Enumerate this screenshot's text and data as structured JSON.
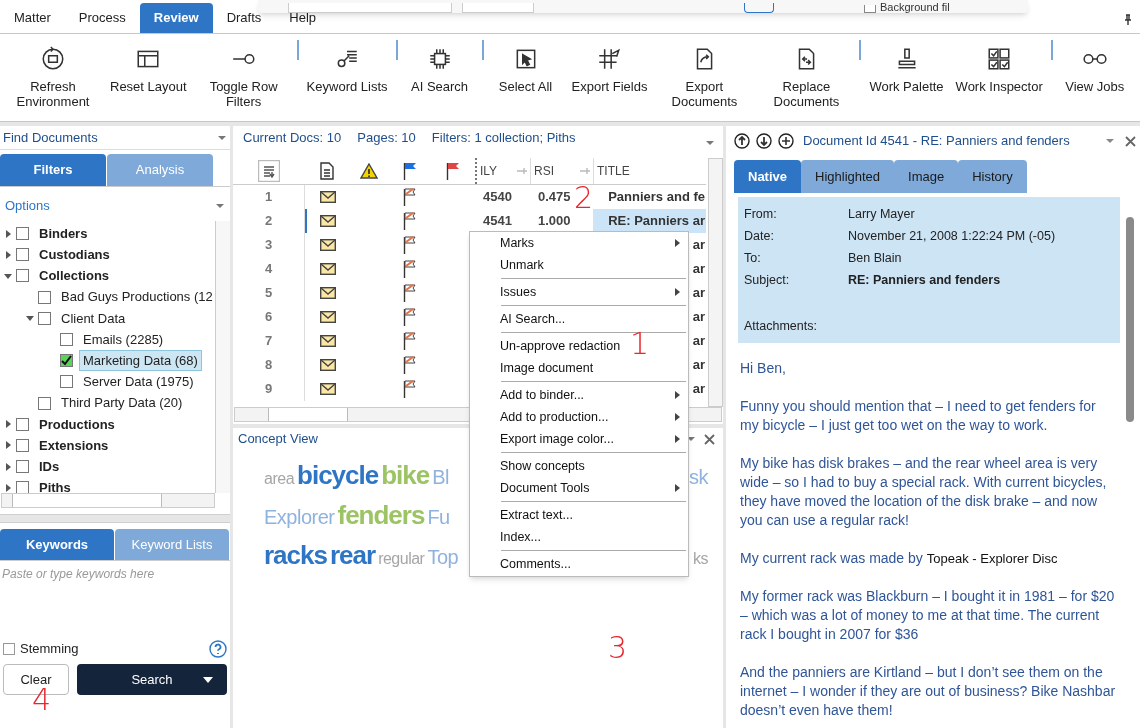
{
  "overlay_dialog": {
    "checkbox_label": "Background fil",
    "checked": false
  },
  "menu_tabs": [
    {
      "label": "Matter",
      "selected": false
    },
    {
      "label": "Process",
      "selected": false
    },
    {
      "label": "Review",
      "selected": true
    },
    {
      "label": "Drafts",
      "selected": false
    },
    {
      "label": "Help",
      "selected": false
    }
  ],
  "toolbar": [
    {
      "label": "Refresh Environment",
      "separator_before": false
    },
    {
      "label": "Reset Layout",
      "separator_before": false
    },
    {
      "label": "Toggle Row Filters",
      "separator_before": false
    },
    {
      "label": "Keyword Lists",
      "separator_before": true
    },
    {
      "label": "AI Search",
      "separator_before": true
    },
    {
      "label": "Select All",
      "separator_before": true
    },
    {
      "label": "Export Fields",
      "separator_before": false
    },
    {
      "label": "Export Documents",
      "separator_before": false
    },
    {
      "label": "Replace Documents",
      "separator_before": false
    },
    {
      "label": "Work Palette",
      "separator_before": true
    },
    {
      "label": "Work Inspector",
      "separator_before": false
    },
    {
      "label": "View Jobs",
      "separator_before": true
    }
  ],
  "find_documents": {
    "title": "Find Documents",
    "tabs": [
      {
        "label": "Filters",
        "selected": true
      },
      {
        "label": "Analysis",
        "selected": false
      }
    ],
    "options_label": "Options",
    "tree": [
      {
        "label": "Binders",
        "checked": false,
        "expanded": false,
        "selected": false
      },
      {
        "label": "Custodians",
        "checked": false,
        "expanded": false,
        "selected": false
      },
      {
        "label": "Collections",
        "checked": false,
        "expanded": true,
        "selected": false,
        "children": [
          {
            "label": "Bad Guys Productions (12",
            "checked": false,
            "selected": false
          },
          {
            "label": "Client Data",
            "checked": false,
            "expanded": true,
            "selected": false,
            "children": [
              {
                "label": "Emails (2285)",
                "checked": false,
                "selected": false
              },
              {
                "label": "Marketing Data (68)",
                "checked": true,
                "selected": true
              },
              {
                "label": "Server Data (1975)",
                "checked": false,
                "selected": false
              }
            ]
          },
          {
            "label": "Third Party Data (20)",
            "checked": false,
            "selected": false
          }
        ]
      },
      {
        "label": "Productions",
        "checked": false,
        "expanded": false,
        "selected": false
      },
      {
        "label": "Extensions",
        "checked": false,
        "expanded": false,
        "selected": false
      },
      {
        "label": "IDs",
        "checked": false,
        "expanded": false,
        "selected": false
      },
      {
        "label": "Piths",
        "checked": false,
        "expanded": false,
        "selected": false
      }
    ]
  },
  "keywords": {
    "tabs": [
      {
        "label": "Keywords",
        "selected": true
      },
      {
        "label": "Keyword Lists",
        "selected": false
      }
    ],
    "placeholder": "Paste or type keywords here",
    "stemming": {
      "label": "Stemming",
      "checked": false
    },
    "clear_button": "Clear",
    "search_button": "Search"
  },
  "results": {
    "current_docs": "Current Docs: 10",
    "pages": "Pages: 10",
    "filters": "Filters: 1 collection; Piths",
    "columns": [
      "ILY",
      "RSI",
      "TITLE"
    ],
    "rows": [
      {
        "number": "1",
        "ily": "4540",
        "rsi": "0.475",
        "title": "Panniers and fe",
        "selected": false
      },
      {
        "number": "2",
        "ily": "4541",
        "rsi": "1.000",
        "title": "RE: Panniers ar",
        "selected": true
      },
      {
        "number": "3",
        "title": "ar",
        "selected": false
      },
      {
        "number": "4",
        "title": "ar",
        "selected": false
      },
      {
        "number": "5",
        "title": "ar",
        "selected": false
      },
      {
        "number": "6",
        "title": "ar",
        "selected": false
      },
      {
        "number": "7",
        "title": "ar",
        "selected": false
      },
      {
        "number": "8",
        "title": "ar",
        "selected": false
      },
      {
        "number": "9",
        "title": "ar",
        "selected": false
      }
    ]
  },
  "concept_view": {
    "title": "Concept View",
    "rows": [
      {
        "left": [
          {
            "text": "area",
            "kind": "small",
            "color": "#a6a6a6"
          },
          {
            "text": "bicycle",
            "kind": "large",
            "color": "#2e75c5"
          },
          {
            "text": "bike",
            "kind": "large",
            "color": "#9cc464"
          },
          {
            "text": "Bl",
            "kind": "medium",
            "color": "#8fb2de"
          }
        ],
        "right": [
          {
            "text": "sk",
            "kind": "medium",
            "color": "#8fb2de"
          }
        ]
      },
      {
        "left": [
          {
            "text": "Explorer",
            "kind": "medium",
            "color": "#8fb2de"
          },
          {
            "text": "fenders",
            "kind": "large",
            "color": "#9cc464"
          },
          {
            "text": "Fu",
            "kind": "medium",
            "color": "#8fb2de"
          }
        ],
        "right": []
      },
      {
        "left": [
          {
            "text": "racks",
            "kind": "large",
            "color": "#2e75c5"
          },
          {
            "text": "rear",
            "kind": "large",
            "color": "#2e75c5"
          },
          {
            "text": "regular",
            "kind": "small",
            "color": "#a6a6a6"
          },
          {
            "text": "Top",
            "kind": "medium",
            "color": "#8fb2de"
          }
        ],
        "right": [
          {
            "text": "ks",
            "kind": "small",
            "color": "#a6a6a6"
          }
        ]
      }
    ]
  },
  "context_menu": [
    {
      "label": "Marks",
      "submenu": true,
      "separator_before": false
    },
    {
      "label": "Unmark",
      "submenu": false,
      "separator_before": false
    },
    {
      "label": "Issues",
      "submenu": true,
      "separator_before": true
    },
    {
      "label": "AI Search...",
      "submenu": false,
      "separator_before": true
    },
    {
      "label": "Un-approve redaction",
      "submenu": false,
      "separator_before": true
    },
    {
      "label": "Image document",
      "submenu": false,
      "separator_before": false
    },
    {
      "label": "Add to binder...",
      "submenu": true,
      "separator_before": true
    },
    {
      "label": "Add to production...",
      "submenu": true,
      "separator_before": false
    },
    {
      "label": "Export image color...",
      "submenu": true,
      "separator_before": false
    },
    {
      "label": "Show concepts",
      "submenu": false,
      "separator_before": true
    },
    {
      "label": "Document Tools",
      "submenu": true,
      "separator_before": false
    },
    {
      "label": "Extract text...",
      "submenu": false,
      "separator_before": true
    },
    {
      "label": "Index...",
      "submenu": false,
      "separator_before": false
    },
    {
      "label": "Comments...",
      "submenu": false,
      "separator_before": true
    }
  ],
  "document": {
    "title": "Document Id 4541 - RE: Panniers and fenders",
    "tabs": [
      {
        "label": "Native",
        "selected": true
      },
      {
        "label": "Highlighted",
        "selected": false
      },
      {
        "label": "Image",
        "selected": false
      },
      {
        "label": "History",
        "selected": false
      }
    ],
    "fields": [
      {
        "label": "From:",
        "value": "Larry Mayer",
        "kind": "plain"
      },
      {
        "label": "Date:",
        "value": "November 21, 2008 1:22:24 PM (-05)",
        "kind": "plain"
      },
      {
        "label": "To:",
        "value": "Ben Blain",
        "kind": "plain"
      },
      {
        "label": "Subject:",
        "value": "RE: Panniers and fenders",
        "kind": "bold"
      },
      {
        "label": "Attachments:",
        "kind": "attachments"
      }
    ],
    "body": [
      [
        {
          "text": "Hi Ben,",
          "kind": "body"
        }
      ],
      [
        {
          "text": "Funny you should mention that – I need to get fenders for my bicycle – I just get too wet on the way to work.",
          "kind": "body"
        }
      ],
      [
        {
          "text": "My bike has disk brakes – and the rear wheel area is very wide – so I had to buy a special rack.  With current bicycles, they have moved the location of the disk brake – and now you can use a regular rack!",
          "kind": "body"
        }
      ],
      [
        {
          "text": "My current rack was made by ",
          "kind": "body"
        },
        {
          "text": "Topeak - Explorer Disc",
          "kind": "quoted"
        }
      ],
      [
        {
          "text": "My former rack was Blackburn – I bought it in 1981 – for $20 – which was a lot of money to me at that time.  The current rack I bought in 2007 for $36",
          "kind": "body"
        }
      ],
      [
        {
          "text": "And the panniers are Kirtland – but I don’t see them on the internet – I wonder if they are out of business?  Bike Nashbar doesn’t even have them!",
          "kind": "body"
        }
      ]
    ]
  },
  "callouts": [
    "1",
    "2",
    "3",
    "4"
  ]
}
